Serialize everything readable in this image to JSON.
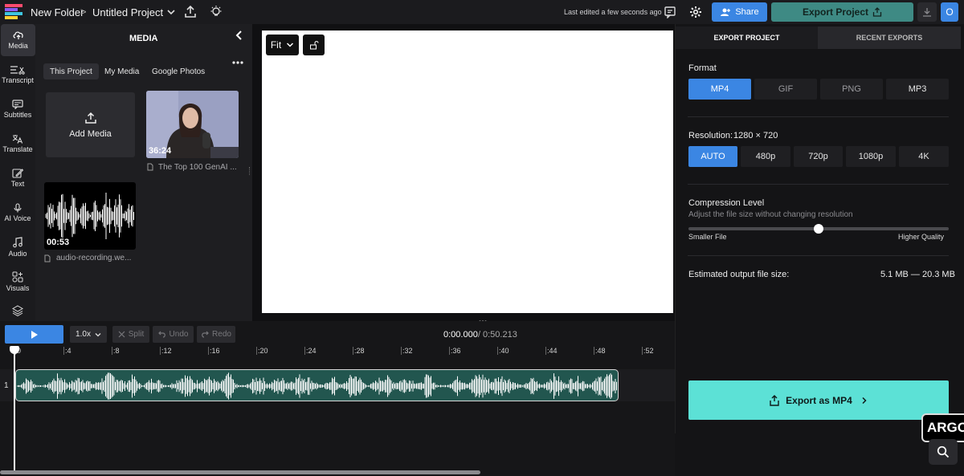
{
  "topbar": {
    "breadcrumb_folder": "New Folder",
    "separator": ">",
    "project_title": "Untitled Project",
    "last_edited": "Last edited a few seconds ago",
    "share_label": "Share",
    "export_label": "Export Project",
    "avatar_initial": "O"
  },
  "rail": {
    "items": [
      {
        "label": "Media",
        "icon": "upload-cloud-icon"
      },
      {
        "label": "Transcript",
        "icon": "transcript-icon"
      },
      {
        "label": "Subtitles",
        "icon": "subtitles-icon"
      },
      {
        "label": "Translate",
        "icon": "translate-icon"
      },
      {
        "label": "Text",
        "icon": "text-edit-icon"
      },
      {
        "label": "AI Voice",
        "icon": "ai-voice-icon"
      },
      {
        "label": "Audio",
        "icon": "music-note-icon"
      },
      {
        "label": "Visuals",
        "icon": "visuals-icon"
      }
    ]
  },
  "media": {
    "title": "MEDIA",
    "tabs": [
      "This Project",
      "My Media",
      "Google Photos"
    ],
    "add_media_label": "Add Media",
    "video_duration": "36:24",
    "video_name": "The Top 100 GenAI ...",
    "audio_duration": "00:53",
    "audio_name": "audio-recording.we..."
  },
  "canvas": {
    "fit_label": "Fit"
  },
  "export": {
    "tabs": [
      "EXPORT PROJECT",
      "RECENT EXPORTS"
    ],
    "format_label": "Format",
    "formats": [
      "MP4",
      "GIF",
      "PNG",
      "MP3"
    ],
    "selected_format": "MP4",
    "resolution_label": "Resolution:",
    "resolution_value": "1280 × 720",
    "resolutions": [
      "AUTO",
      "480p",
      "720p",
      "1080p",
      "4K"
    ],
    "selected_resolution": "AUTO",
    "compression_title": "Compression Level",
    "compression_desc": "Adjust the file size without changing resolution",
    "compression_level": 0.5,
    "smaller_label": "Smaller File",
    "higher_label": "Higher Quality",
    "estimate_label": "Estimated output file size:",
    "estimate_value": "5.1 MB — 20.3 MB",
    "export_button_label": "Export as MP4",
    "accent_color": "#3b86e3",
    "export_button_color": "#5ce1d6"
  },
  "timeline": {
    "speed_label": "1.0x",
    "split_label": "Split",
    "undo_label": "Undo",
    "redo_label": "Redo",
    "current_time": "0:00.000",
    "time_separator": "/",
    "total_time": "0:50.213",
    "ticks": [
      "0",
      ":4",
      ":8",
      ":12",
      ":16",
      ":20",
      ":24",
      ":28",
      ":32",
      ":36",
      ":40",
      ":44",
      ":48",
      ":52"
    ],
    "track_number": "1"
  },
  "badge": {
    "label": "ARGO"
  }
}
